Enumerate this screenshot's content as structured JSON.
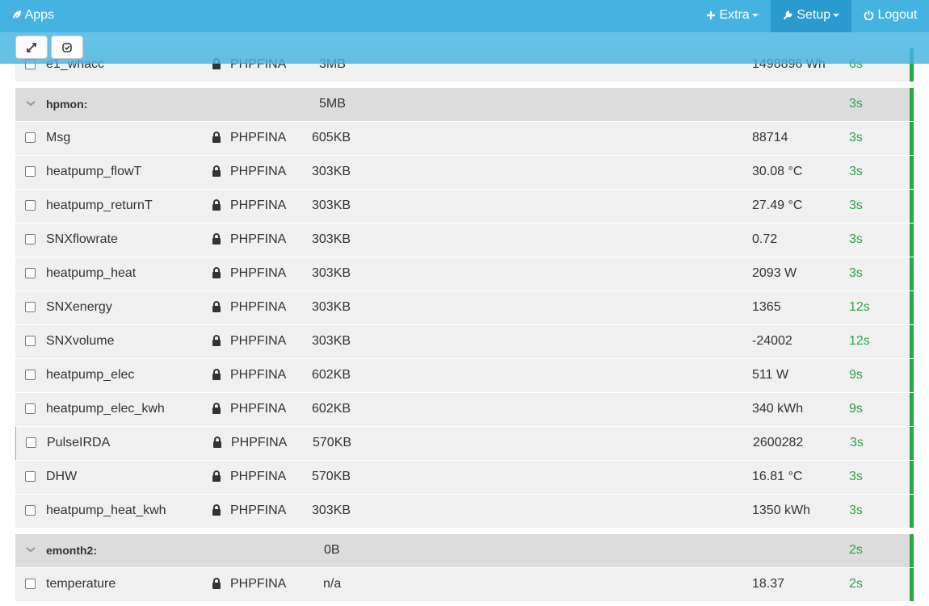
{
  "navbar": {
    "apps_label": "Apps",
    "extra_label": "Extra",
    "setup_label": "Setup",
    "logout_label": "Logout"
  },
  "toolbar": {
    "expand_icon": "expand-arrows-icon",
    "select_icon": "check-square-icon"
  },
  "colors": {
    "navbar": "#44b3e2",
    "updated_ok": "#28a745",
    "row_bg": "#f0f0f0",
    "group_bg": "#dcdcdc"
  },
  "partial_row": {
    "name": "e1_whacc",
    "engine": "PHPFINA",
    "size": "3MB",
    "value": "1498896 Wh",
    "updated": "6s"
  },
  "groups": [
    {
      "name": "hpmon:",
      "size": "5MB",
      "updated": "3s",
      "feeds": [
        {
          "name": "Msg",
          "engine": "PHPFINA",
          "size": "605KB",
          "value": "88714",
          "updated": "3s"
        },
        {
          "name": "heatpump_flowT",
          "engine": "PHPFINA",
          "size": "303KB",
          "value": "30.08 °C",
          "updated": "3s"
        },
        {
          "name": "heatpump_returnT",
          "engine": "PHPFINA",
          "size": "303KB",
          "value": "27.49 °C",
          "updated": "3s"
        },
        {
          "name": "SNXflowrate",
          "engine": "PHPFINA",
          "size": "303KB",
          "value": "0.72",
          "updated": "3s"
        },
        {
          "name": "heatpump_heat",
          "engine": "PHPFINA",
          "size": "303KB",
          "value": "2093 W",
          "updated": "3s"
        },
        {
          "name": "SNXenergy",
          "engine": "PHPFINA",
          "size": "303KB",
          "value": "1365",
          "updated": "12s"
        },
        {
          "name": "SNXvolume",
          "engine": "PHPFINA",
          "size": "303KB",
          "value": "-24002",
          "updated": "12s"
        },
        {
          "name": "heatpump_elec",
          "engine": "PHPFINA",
          "size": "602KB",
          "value": "511 W",
          "updated": "9s"
        },
        {
          "name": "heatpump_elec_kwh",
          "engine": "PHPFINA",
          "size": "602KB",
          "value": "340 kWh",
          "updated": "9s"
        },
        {
          "name": "PulseIRDA",
          "engine": "PHPFINA",
          "size": "570KB",
          "value": "2600282",
          "updated": "3s"
        },
        {
          "name": "DHW",
          "engine": "PHPFINA",
          "size": "570KB",
          "value": "16.81 °C",
          "updated": "3s"
        },
        {
          "name": "heatpump_heat_kwh",
          "engine": "PHPFINA",
          "size": "303KB",
          "value": "1350 kWh",
          "updated": "3s"
        }
      ]
    },
    {
      "name": "emonth2:",
      "size": "0B",
      "updated": "2s",
      "feeds": [
        {
          "name": "temperature",
          "engine": "PHPFINA",
          "size": "n/a",
          "value": "18.37",
          "updated": "2s"
        }
      ]
    }
  ]
}
